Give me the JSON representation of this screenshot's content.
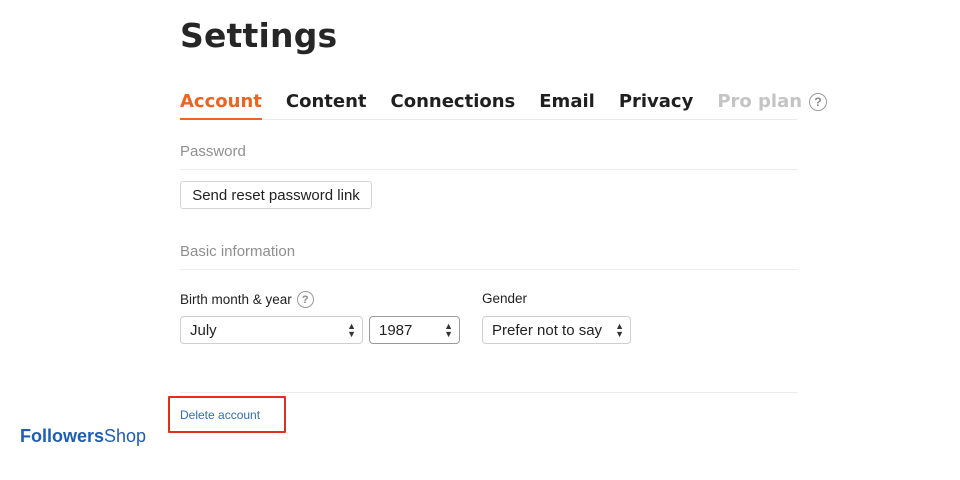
{
  "page": {
    "title": "Settings"
  },
  "tabs": [
    {
      "label": "Account",
      "state": "active"
    },
    {
      "label": "Content",
      "state": "normal"
    },
    {
      "label": "Connections",
      "state": "normal"
    },
    {
      "label": "Email",
      "state": "normal"
    },
    {
      "label": "Privacy",
      "state": "normal"
    },
    {
      "label": "Pro plan",
      "state": "disabled",
      "help": "?"
    }
  ],
  "password": {
    "section_title": "Password",
    "reset_button": "Send reset password link"
  },
  "basic_info": {
    "section_title": "Basic information",
    "birth_label": "Birth month & year",
    "birth_help": "?",
    "month_value": "July",
    "year_value": "1987",
    "gender_label": "Gender",
    "gender_value": "Prefer not to say"
  },
  "danger": {
    "delete_link": "Delete account",
    "highlight_color": "#e32d1f"
  },
  "brand": {
    "part1": "Followers",
    "part2": "Shop"
  },
  "colors": {
    "accent": "#ee6321",
    "link": "#2d6fbd"
  }
}
